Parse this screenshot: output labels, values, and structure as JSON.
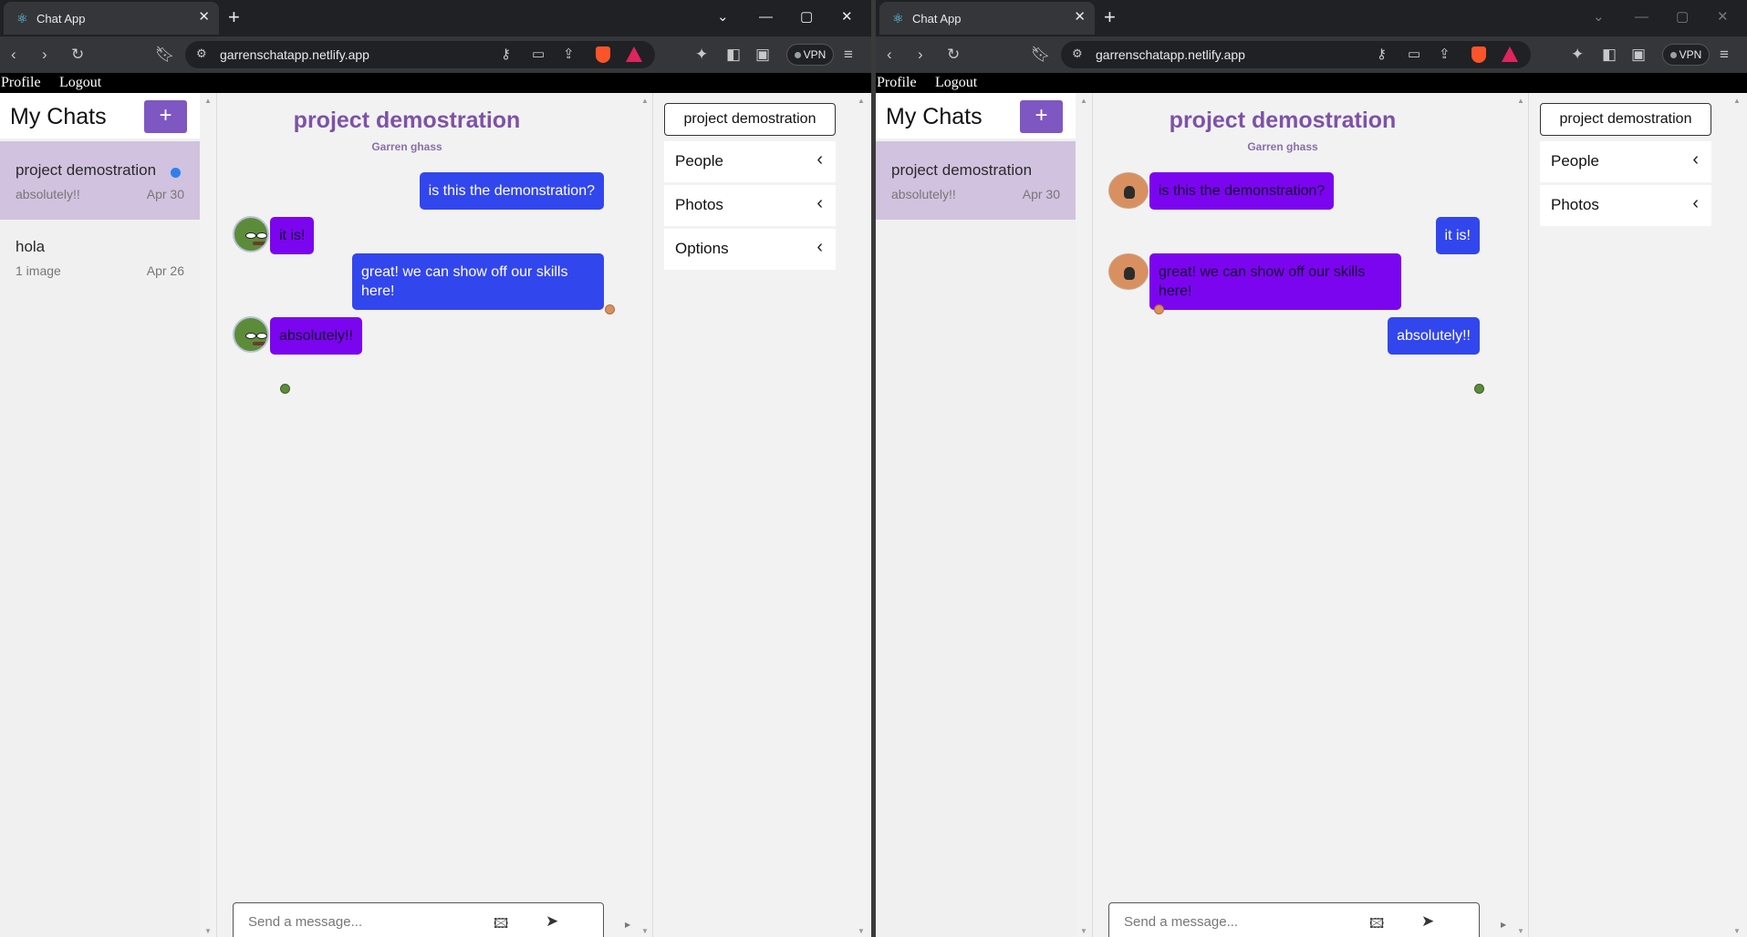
{
  "browser": {
    "tab_title": "Chat App",
    "url": "garrenschatapp.netlify.app",
    "vpn_label": "VPN"
  },
  "nav": {
    "profile": "Profile",
    "logout": "Logout"
  },
  "sidebar": {
    "title": "My Chats",
    "add_label": "+",
    "chats": [
      {
        "name": "project demostration",
        "last": "absolutely!!",
        "date": "Apr 30"
      },
      {
        "name": "hola",
        "last": "1 image",
        "date": "Apr 26"
      }
    ]
  },
  "chat": {
    "title": "project demostration",
    "subtitle": "Garren ghass",
    "messages": [
      {
        "text": "is this the demonstration?"
      },
      {
        "text": "it is!"
      },
      {
        "text": "great! we can show off our skills here!"
      },
      {
        "text": "absolutely!!"
      }
    ],
    "placeholder": "Send a message..."
  },
  "details": {
    "title": "project demostration",
    "people": "People",
    "photos": "Photos",
    "options": "Options"
  },
  "icons": {
    "tab": "react-icon",
    "image_button": "image-icon",
    "send_button": "send-icon",
    "expand": "chevron-left-icon"
  },
  "colors": {
    "accent": "#7e57c2",
    "selected_chat": "#d1c2df",
    "own_bubble": "#3246ee",
    "other_bubble": "#7b05ef",
    "unread_dot": "#2f80ed"
  }
}
